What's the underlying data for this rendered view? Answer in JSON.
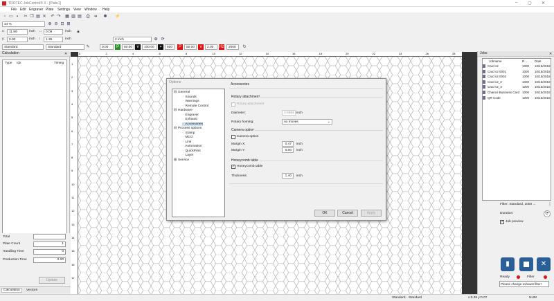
{
  "window": {
    "title": "TROTEC JobControl® X - [Plate1]",
    "controls": [
      "–",
      "▢",
      "✕"
    ]
  },
  "menu": [
    "File",
    "Edit",
    "Engraver",
    "Plate",
    "Settings",
    "View",
    "Window",
    "Help"
  ],
  "toolbar": {
    "zoom": "34 %",
    "x_val": "11.99",
    "x_unit": "inch",
    "w_val": "0.09",
    "w_unit": "inch",
    "y_val": "0.00",
    "y_unit": "inch",
    "h_val": "1.35",
    "h_unit": "inch",
    "step_val": "2 inch",
    "material_profile": "Standard",
    "material_profile2": "Standard",
    "params": [
      "0.00",
      "50.00",
      "100.00",
      "500",
      "50.00",
      "2.00",
      "2000"
    ]
  },
  "calculation": {
    "title": "Calculation",
    "cols": [
      "Type",
      "Idx",
      "Timing"
    ],
    "total_label": "Total",
    "plate_count_label": "Plate Count",
    "plate_count": "1",
    "handling_label": "Handling Time",
    "handling": "0",
    "production_label": "Production Time",
    "production": "0.00",
    "update_btn": "Update",
    "tabs": [
      "Calculation",
      "Vectors"
    ]
  },
  "ruler": {
    "top": [
      "0",
      "2",
      "4",
      "6",
      "8",
      "10",
      "12",
      "14",
      "16",
      "18",
      "20",
      "22",
      "24",
      "26",
      "28"
    ],
    "left": [
      "1",
      "2",
      "3",
      "4",
      "5",
      "6",
      "7",
      "8",
      "9",
      "10",
      "11",
      "12",
      "13",
      "14",
      "15",
      "16",
      "17"
    ]
  },
  "jobs": {
    "title": "Jobs",
    "cols": [
      "Jobname",
      "R...",
      "Date"
    ],
    "rows": [
      {
        "name": "Card v2",
        "r": "1000",
        "date": "10/15/2018"
      },
      {
        "name": "Card v2 0001",
        "r": "1000",
        "date": "10/15/2018"
      },
      {
        "name": "Card v2 0002",
        "r": "1000",
        "date": "10/15/2018"
      },
      {
        "name": "Card v2_2",
        "r": "1000",
        "date": "10/15/2018"
      },
      {
        "name": "Card v2_3",
        "r": "1000",
        "date": "10/15/2018"
      },
      {
        "name": "Chance Business Card",
        "r": "1000",
        "date": "10/15/2018"
      },
      {
        "name": "QR Code",
        "r": "1000",
        "date": "10/15/2018"
      }
    ],
    "filter": "Filter: Standard, 1000 ...",
    "duration_label": "Duration:",
    "job_preview": "Job preview",
    "ready": "Ready",
    "filter_status": "Filter",
    "message": "Please change exhaust filter!"
  },
  "status": {
    "profile": "Standard - Standard",
    "coords": "x:0.39 y:0.07",
    "mode": "NUM"
  },
  "dialog": {
    "title": "Options",
    "tree": [
      {
        "label": "General",
        "level": 0,
        "expander": "⊟"
      },
      {
        "label": "Sounds",
        "level": 1
      },
      {
        "label": "Warnings",
        "level": 1
      },
      {
        "label": "Remote Control",
        "level": 1
      },
      {
        "label": "Hardware",
        "level": 0,
        "expander": "⊟"
      },
      {
        "label": "Engraver",
        "level": 1
      },
      {
        "label": "Exhaust",
        "level": 1
      },
      {
        "label": "Accessories",
        "level": 1,
        "selected": true
      },
      {
        "label": "Process options",
        "level": 0,
        "expander": "⊟"
      },
      {
        "label": "Stamp",
        "level": 1
      },
      {
        "label": "MCO",
        "level": 1
      },
      {
        "label": "Link",
        "level": 1
      },
      {
        "label": "Automation",
        "level": 1
      },
      {
        "label": "QuickPrint",
        "level": 1
      },
      {
        "label": "Layer",
        "level": 1
      },
      {
        "label": "Service",
        "level": 0,
        "expander": "⊞"
      }
    ],
    "heading": "Accessories",
    "rotary_section": "Rotary attachment",
    "rotary_attachment": "Rotary attachment",
    "diameter_label": "Diameter:",
    "diameter_val": "3.5984",
    "diameter_unit": "inch",
    "homing_label": "Rotary homing:",
    "homing_val": "no moves",
    "camera_section": "Camera option",
    "camera_option": "Camera option",
    "margin_x_label": "Margin X:",
    "margin_x_val": "0.47",
    "margin_x_unit": "inch",
    "margin_y_label": "Margin Y:",
    "margin_y_val": "0.00",
    "margin_y_unit": "inch",
    "honeycomb_section": "Honeycomb table",
    "honeycomb_table": "Honeycomb table",
    "thickness_label": "Thickness:",
    "thickness_val": "1.40",
    "thickness_unit": "inch",
    "ok": "OK",
    "cancel": "Cancel",
    "apply": "Apply"
  }
}
